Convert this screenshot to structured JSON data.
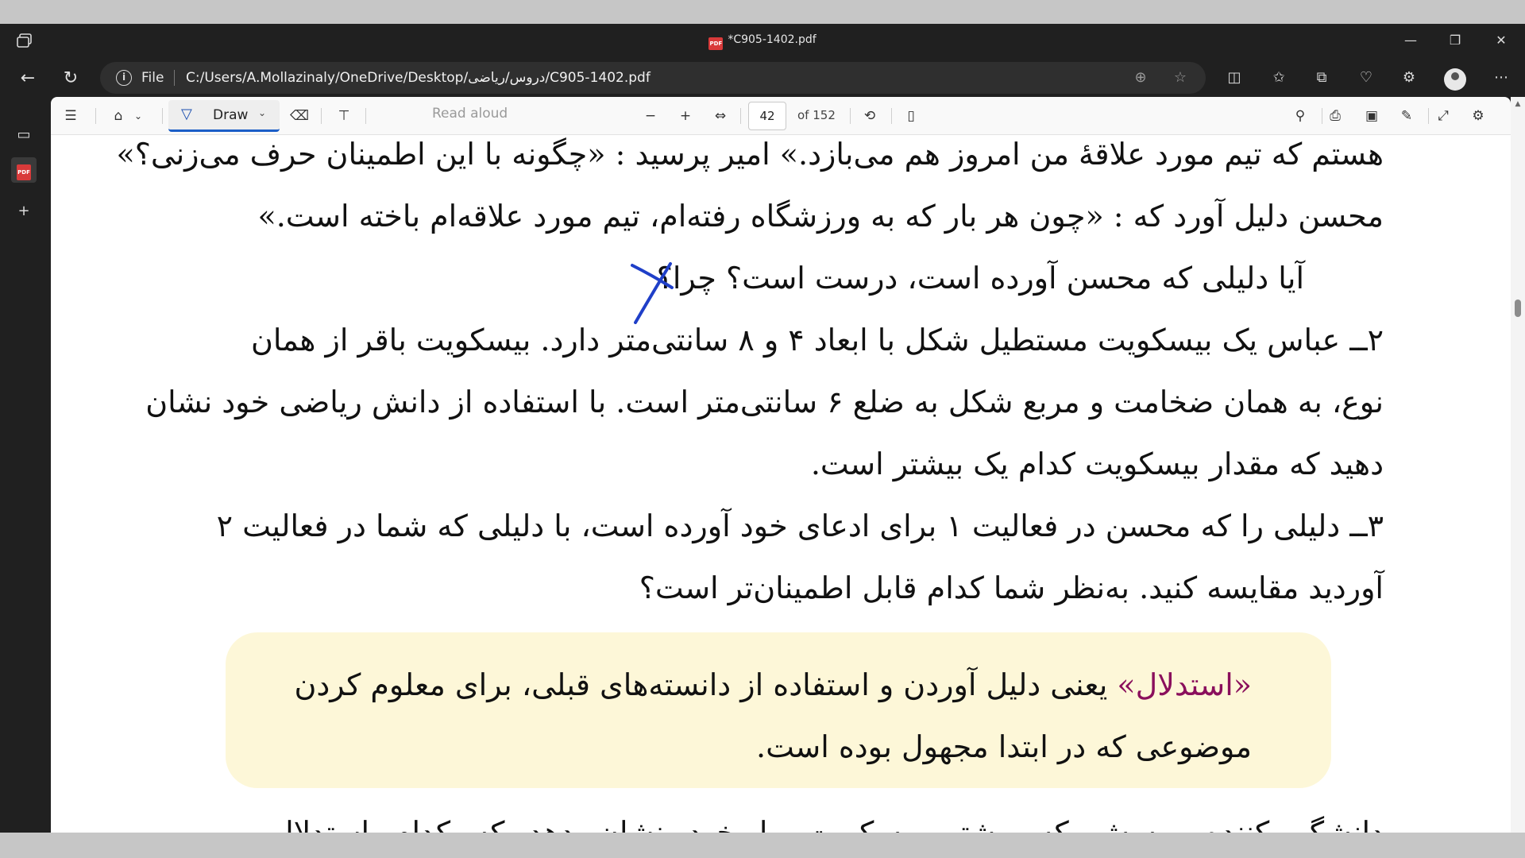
{
  "window": {
    "title": "*C905-1402.pdf",
    "pdf_icon_text": "PDF"
  },
  "addressbar": {
    "info_glyph": "i",
    "file_label": "File",
    "url": "C:/Users/A.Mollazinaly/OneDrive/Desktop/دروس/ریاضی/C905-1402.pdf"
  },
  "toolbar": {
    "draw_label": "Draw",
    "read_aloud_label": "Read aloud",
    "page_number": "42",
    "page_total": "of 152"
  },
  "document": {
    "lines": [
      "هستم که تیم مورد علاقهٔ من امروز هم می‌بازد.» امیر پرسید : «چگونه با این اطمینان حرف می‌زنی؟»",
      "محسن دلیل آورد که : «چون هر بار که به ورزشگاه رفته‌ام، تیم مورد علاقه‌ام باخته است.»",
      "آیا دلیلی که محسن آورده است، درست است؟ چرا؟",
      "۲ــ عباس یک بیسکویت مستطیل شکل با ابعاد ۴ و ۸ سانتی‌متر دارد. بیسکویت باقر از همان",
      "نوع، به همان ضخامت و مربع شکل به ضلع ۶ سانتی‌متر است. با استفاده از دانش ریاضی خود نشان",
      "دهید که مقدار بیسکویت کدام یک بیشتر است.",
      "۳ــ دلیلی را که محسن در فعالیت ۱ برای ادعای خود آورده است، با دلیلی که شما در فعالیت ۲",
      "آوردید مقایسه کنید. به‌نظر شما کدام قابل اطمینان‌تر است؟"
    ],
    "callout": {
      "term": "«استدلال»",
      "line1_rest": " یعنی دلیل آوردن و استفاده از دانسته‌های قبلی، برای معلوم کردن",
      "line2": "موضوعی که در ابتدا مجهول بوده است."
    },
    "cut_line": "دانشگر کننده پرسش که بیشتر بیسکویت را خود نشان دهد که کدام استدلال"
  },
  "colors": {
    "callout_bg": "#fdf7d8",
    "term_color": "#8a0f5c",
    "ink_color": "#1f3fc8",
    "draw_accent": "#1b5ec7"
  }
}
